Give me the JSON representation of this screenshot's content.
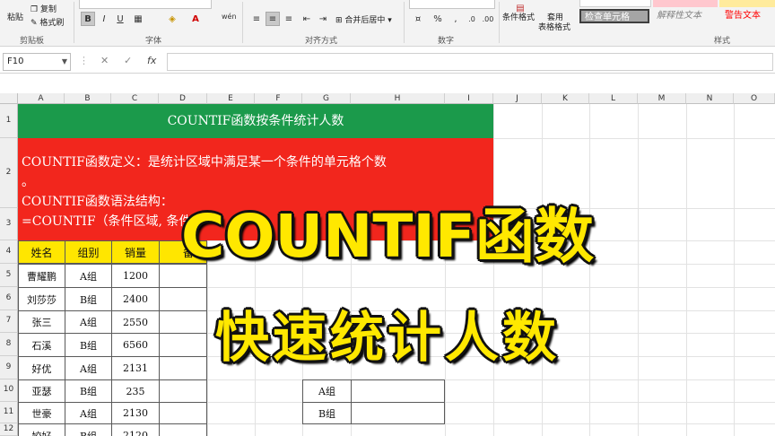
{
  "ribbon": {
    "clipboard": {
      "paste": "粘贴",
      "copy": "复制",
      "format_painter": "格式刷",
      "group": "剪贴板"
    },
    "font": {
      "group": "字体",
      "bold": "B",
      "italic": "I",
      "underline": "U"
    },
    "alignment": {
      "group": "对齐方式",
      "merge_center": "合并后居中"
    },
    "number": {
      "group": "数字",
      "percent": "%"
    },
    "styles": {
      "group": "样式",
      "conditional_format": "条件格式",
      "table_format_1": "套用",
      "table_format_2": "表格格式",
      "check_cell": "检查单元格",
      "explanatory_text": "解释性文本",
      "warning_text": "警告文本"
    }
  },
  "formula_bar": {
    "name_box": "F10",
    "cancel": "✕",
    "enter": "✓",
    "fx": "fx",
    "value": ""
  },
  "columns": [
    "A",
    "B",
    "C",
    "D",
    "E",
    "F",
    "G",
    "H",
    "I",
    "J",
    "K",
    "L",
    "M",
    "N",
    "O"
  ],
  "rows": [
    "1",
    "2",
    "3",
    "4",
    "5",
    "6",
    "7",
    "8",
    "9",
    "10",
    "11",
    "12"
  ],
  "sheet": {
    "title": "COUNTIF函数按条件统计人数",
    "definition": "COUNTIF函数定义：是统计区域中满足某一个条件的单元格个数",
    "definition_wrap": "。",
    "syntax_label": "COUNTIF函数语法结构：",
    "syntax": "=COUNTIF（条件区域, 条件）",
    "headers": [
      "姓名",
      "组别",
      "销量",
      "备注"
    ],
    "table": [
      [
        "曹耀鹏",
        "A组",
        "1200"
      ],
      [
        "刘莎莎",
        "B组",
        "2400"
      ],
      [
        "张三",
        "A组",
        "2550"
      ],
      [
        "石溪",
        "B组",
        "6560"
      ],
      [
        "好优",
        "A组",
        "2131"
      ],
      [
        "亚瑟",
        "B组",
        "235"
      ],
      [
        "世豪",
        "A组",
        "2130"
      ],
      [
        "姣好",
        "B组",
        "2120"
      ]
    ],
    "summary": [
      {
        "group": "A组",
        "count": ""
      },
      {
        "group": "B组",
        "count": ""
      }
    ]
  },
  "overlay": {
    "line1": "COUNTIF函数",
    "line2": "快速统计人数"
  },
  "colors": {
    "title_bg": "#1b9a4b",
    "definition_bg": "#f2261d",
    "header_bg": "#ffe600",
    "overlay_text": "#ffe800"
  }
}
